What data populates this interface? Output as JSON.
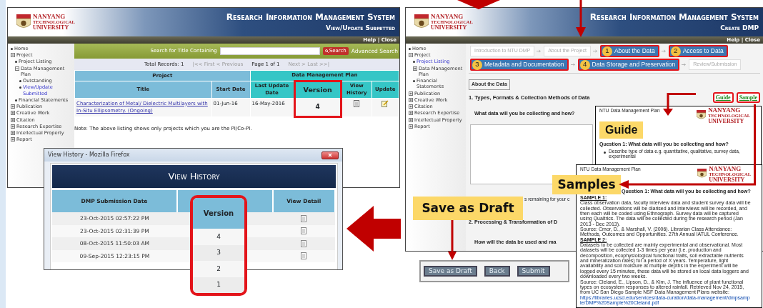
{
  "left_window": {
    "logo": [
      "NANYANG",
      "TECHNOLOGICAL",
      "UNIVERSITY"
    ],
    "system_title": "Research Information Management System",
    "page_title": "View/Update Submitted",
    "top_links": "Help | Close",
    "sidebar": [
      {
        "label": "Home",
        "kind": "bullet",
        "selected": false
      },
      {
        "label": "Project",
        "kind": "expander",
        "expanded": true,
        "selected": false,
        "children": [
          {
            "label": "Project Listing",
            "kind": "bullet",
            "selected": false
          },
          {
            "label": "Data Management Plan",
            "kind": "expander",
            "expanded": true,
            "selected": false,
            "children": [
              {
                "label": "Outstanding",
                "kind": "bullet",
                "selected": false
              },
              {
                "label": "View/Update Submitted",
                "kind": "bullet",
                "selected": true
              }
            ]
          },
          {
            "label": "Financial Statements",
            "kind": "bullet",
            "selected": false
          }
        ]
      },
      {
        "label": "Publication",
        "kind": "expander",
        "expanded": false,
        "selected": false
      },
      {
        "label": "Creative Work",
        "kind": "expander",
        "expanded": false,
        "selected": false
      },
      {
        "label": "Citation",
        "kind": "expander",
        "expanded": false,
        "selected": false
      },
      {
        "label": "Research Expertise",
        "kind": "expander",
        "expanded": false,
        "selected": false
      },
      {
        "label": "Intellectual Property",
        "kind": "expander",
        "expanded": false,
        "selected": false
      },
      {
        "label": "Report",
        "kind": "expander",
        "expanded": false,
        "selected": false
      }
    ],
    "search": {
      "label": "Search for Title Containing",
      "button": "Search",
      "advanced_link": "Advanced Search"
    },
    "pager": {
      "total": "Total Records: 1",
      "first_previous": "|<< First < Previous",
      "page": "Page 1 of 1",
      "next_last": "Next > Last >>|"
    },
    "table": {
      "groups": [
        {
          "label": "Project",
          "columns": [
            {
              "label": "Title",
              "highlighted": false
            },
            {
              "label": "Start Date",
              "highlighted": false
            }
          ]
        },
        {
          "label": "Data Management Plan",
          "columns": [
            {
              "label": "Last Update Date",
              "highlighted": false
            },
            {
              "label": "Version",
              "highlighted": true
            },
            {
              "label": "View History",
              "highlighted": false
            },
            {
              "label": "Update",
              "highlighted": false
            }
          ]
        }
      ],
      "rows": [
        [
          {
            "kind": "link",
            "text": "Characterization of Metal/ Dielectric Multilayers with In-Situ Ellipsometry. (Ongoing)"
          },
          {
            "kind": "text",
            "text": "01-Jun-16"
          },
          {
            "kind": "text",
            "text": "16-May-2016"
          },
          {
            "kind": "text",
            "text": "4"
          },
          {
            "kind": "document"
          },
          {
            "kind": "edit"
          }
        ]
      ]
    },
    "note": "Note: The above listing shows only projects which you are the PI/Co-PI."
  },
  "history_popup": {
    "title": "View History - Mozilla Firefox",
    "banner": "View History",
    "columns": [
      "DMP Submission Date",
      "Version",
      "View Detail"
    ],
    "rows": [
      {
        "date": "23-Oct-2015 02:57:22 PM",
        "version": "4"
      },
      {
        "date": "23-Oct-2015 02:31:39 PM",
        "version": "3"
      },
      {
        "date": "08-Oct-2015 11:50:03 AM",
        "version": "2"
      },
      {
        "date": "09-Sep-2015 12:23:15 PM",
        "version": "1"
      }
    ]
  },
  "right_window": {
    "logo": [
      "NANYANG",
      "TECHNOLOGICAL",
      "UNIVERSITY"
    ],
    "system_title": "Research Information Management System",
    "page_title": "Create DMP",
    "top_links": "Help | Close",
    "sidebar": [
      {
        "label": "Home",
        "kind": "bullet",
        "selected": false
      },
      {
        "label": "Project",
        "kind": "expander",
        "expanded": true,
        "selected": false,
        "children": [
          {
            "label": "Project Listing",
            "kind": "bullet",
            "selected": true
          },
          {
            "label": "Data Management Plan",
            "kind": "expander",
            "expanded": false,
            "selected": false
          },
          {
            "label": "Financial Statements",
            "kind": "bullet",
            "selected": false
          }
        ]
      },
      {
        "label": "Publication",
        "kind": "expander",
        "expanded": false,
        "selected": false
      },
      {
        "label": "Creative Work",
        "kind": "expander",
        "expanded": false,
        "selected": false
      },
      {
        "label": "Citation",
        "kind": "expander",
        "expanded": false,
        "selected": false
      },
      {
        "label": "Research Expertise",
        "kind": "expander",
        "expanded": false,
        "selected": false
      },
      {
        "label": "Intellectual Property",
        "kind": "expander",
        "expanded": false,
        "selected": false
      },
      {
        "label": "Report",
        "kind": "expander",
        "expanded": false,
        "selected": false
      }
    ],
    "step_rows": [
      [
        {
          "label": "Introduction to NTU DMP",
          "disabled": true
        },
        {
          "label": "About the Project",
          "disabled": true
        },
        {
          "label": "About the Data",
          "number": "1",
          "disabled": false
        },
        {
          "label": "Access to Data",
          "number": "2",
          "disabled": false
        }
      ],
      [
        {
          "label": "Metadata and Documentation",
          "number": "3",
          "disabled": false
        },
        {
          "label": "Data Storage and Preservation",
          "number": "4",
          "disabled": false
        },
        {
          "label": "Review/Submission",
          "disabled": true
        }
      ]
    ],
    "section": {
      "legend": "About the Data",
      "heading": "1. Types, Formats & Collection Methods of Data",
      "help_links": [
        "Guide",
        "Sample"
      ],
      "question": "What data will you be collecting and how?",
      "counter": "s remaining for your c",
      "next_heading": "2. Processing & Transformation of D",
      "next_question": "How will the data be used and ma"
    }
  },
  "buttons": [
    "Save as Draft",
    "Back",
    "Submit"
  ],
  "save_callout": "Save as Draft",
  "guide_doc": {
    "header": "NTU Data Management Plan",
    "logo": [
      "NANYANG",
      "TECHNOLOGICAL",
      "UNIVERSITY"
    ],
    "label": "Guide",
    "question": "Question 1: What data will you be collecting and how?",
    "bullets": [
      "Describe type of data e.g. quantitative, qualitative, survey data, experimental"
    ]
  },
  "samples_doc": {
    "header": "NTU Data Management Plan",
    "logo": [
      "NANYANG",
      "TECHNOLOGICAL",
      "UNIVERSITY"
    ],
    "label": "Samples",
    "question": "Question 1: What data will you be collecting and how?",
    "blocks": [
      {
        "kind": "heading",
        "text": "SAMPLE 1:"
      },
      {
        "kind": "body",
        "text": "Class observation data, faculty interview data and student survey data will be collected.  Observations will be diarised and interviews will be recorded, and then each will be coded using Ethnograph. Survey data will be captured using Qualtrics. The data will be collected during the research period (Jan 2013 - Dec 2013)."
      },
      {
        "kind": "source",
        "label": "Source:",
        "text": "Cmor, D., & Marshall, V. (2006). Librarian Class Attendance: Methods, Outcomes and Opportunities. 27th Annual IATUL Conference."
      },
      {
        "kind": "heading",
        "text": "SAMPLE 2:"
      },
      {
        "kind": "body",
        "text": "Datasets to be collected are mainly experimental and observational. Most datasets will be collected 1-3 times per year (i.e. production and decomposition, ecophysiological functional traits, soil extractable nutrients and mineralization rates) for a period of X years. Temperature, light availability and soil moisture at multiple depths in the experiment will be logged every 15 minutes, these data will be stored on local data loggers and downloaded every two weeks."
      },
      {
        "kind": "source",
        "label": "Source:",
        "text": "Cleland, E., Lipson, D., & Kim, J. The influence of plant functional types on ecosystem responses to altered rainfall. Retrieved Nov 24, 2015, from UC San Diego Sample NSF Data Management Plans website:"
      },
      {
        "kind": "link",
        "text": "https://libraries.ucsd.edu/services/data-curation/data-management/dmpsample/DMP%20Sample%20Cleland.pdf"
      }
    ]
  }
}
